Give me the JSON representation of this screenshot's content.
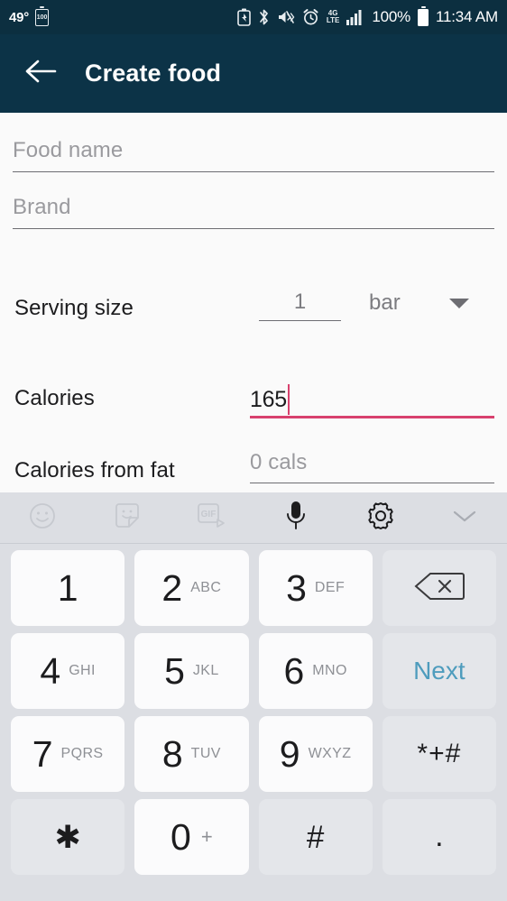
{
  "status_bar": {
    "temperature": "49°",
    "battery_left_label": "100",
    "network_label_top": "4G",
    "network_label_mid": "LTE",
    "battery_percent": "100%",
    "time": "11:34 AM",
    "icons": [
      "battery-saver-icon",
      "bluetooth-icon",
      "vibrate-mute-icon",
      "alarm-icon",
      "lte-data-icon",
      "signal-bars-icon",
      "battery-icon"
    ],
    "background_color": "#0c2f40"
  },
  "app_bar": {
    "back_icon": "arrow-left-icon",
    "title": "Create food",
    "background_color": "#0c3347",
    "text_color": "#ffffff"
  },
  "form": {
    "background_color": "#fafafa",
    "food_name": {
      "label": "Food name",
      "placeholder": "Food name",
      "value": ""
    },
    "brand": {
      "label": "Brand",
      "placeholder": "Brand",
      "value": ""
    },
    "serving_size": {
      "label": "Serving size",
      "value": "1",
      "unit": "bar",
      "dropdown_icon": "chevron-down-icon"
    },
    "calories": {
      "label": "Calories",
      "value": "165",
      "focused": true,
      "accent_color": "#d8416e"
    },
    "calories_from_fat": {
      "label": "Calories from fat",
      "placeholder": "0 cals",
      "value": ""
    }
  },
  "keyboard": {
    "background_color": "#dcdee3",
    "toolbar": [
      {
        "name": "emoji-icon",
        "label": ""
      },
      {
        "name": "sticker-icon",
        "label": ""
      },
      {
        "name": "gif-icon",
        "label": "GIF"
      },
      {
        "name": "microphone-icon",
        "label": ""
      },
      {
        "name": "gear-icon",
        "label": ""
      },
      {
        "name": "chevron-down-icon",
        "label": ""
      }
    ],
    "next_label": "Next",
    "next_color": "#4e9cbd",
    "rows": [
      [
        {
          "digit": "1",
          "letters": "",
          "style": "white",
          "name": "key-1"
        },
        {
          "digit": "2",
          "letters": "ABC",
          "style": "white",
          "name": "key-2"
        },
        {
          "digit": "3",
          "letters": "DEF",
          "style": "white",
          "name": "key-3"
        },
        {
          "digit": "",
          "letters": "",
          "style": "grey",
          "name": "key-backspace",
          "icon": "backspace-icon"
        }
      ],
      [
        {
          "digit": "4",
          "letters": "GHI",
          "style": "white",
          "name": "key-4"
        },
        {
          "digit": "5",
          "letters": "JKL",
          "style": "white",
          "name": "key-5"
        },
        {
          "digit": "6",
          "letters": "MNO",
          "style": "white",
          "name": "key-6"
        },
        {
          "digit": "",
          "letters": "",
          "style": "grey",
          "name": "key-next",
          "text": "Next"
        }
      ],
      [
        {
          "digit": "7",
          "letters": "PQRS",
          "style": "white",
          "name": "key-7"
        },
        {
          "digit": "8",
          "letters": "TUV",
          "style": "white",
          "name": "key-8"
        },
        {
          "digit": "9",
          "letters": "WXYZ",
          "style": "white",
          "name": "key-9"
        },
        {
          "digit": "",
          "letters": "",
          "style": "grey",
          "name": "key-symbols",
          "text": "*+#"
        }
      ],
      [
        {
          "digit": "",
          "letters": "",
          "style": "grey",
          "name": "key-asterisk",
          "text": "✱"
        },
        {
          "digit": "0",
          "letters": "",
          "plus": "+",
          "style": "white",
          "name": "key-0"
        },
        {
          "digit": "",
          "letters": "",
          "style": "grey",
          "name": "key-hash",
          "text": "#"
        },
        {
          "digit": "",
          "letters": "",
          "style": "grey",
          "name": "key-period",
          "text": "."
        }
      ]
    ]
  }
}
